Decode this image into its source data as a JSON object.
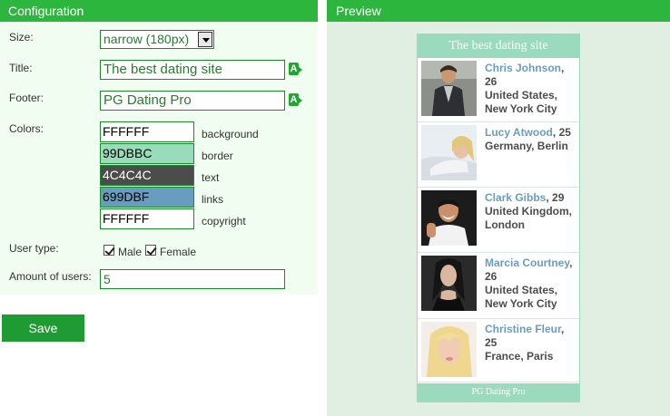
{
  "config": {
    "header": "Configuration",
    "size": {
      "label": "Size:",
      "value": "narrow (180px)"
    },
    "title": {
      "label": "Title:",
      "value": "The best dating site"
    },
    "footer": {
      "label": "Footer:",
      "value": "PG Dating Pro"
    },
    "colors": {
      "label": "Colors:",
      "items": [
        {
          "value": "FFFFFF",
          "name": "background",
          "bg": "#FFFFFF",
          "fg": "#000000"
        },
        {
          "value": "99DBBC",
          "name": "border",
          "bg": "#99DBBC",
          "fg": "#000000"
        },
        {
          "value": "4C4C4C",
          "name": "text",
          "bg": "#4C4C4C",
          "fg": "#FFFFFF"
        },
        {
          "value": "699DBF",
          "name": "links",
          "bg": "#699DBF",
          "fg": "#000000"
        },
        {
          "value": "FFFFFF",
          "name": "copyright",
          "bg": "#FFFFFF",
          "fg": "#000000"
        }
      ]
    },
    "user_type": {
      "label": "User type:",
      "male": "Male",
      "female": "Female",
      "male_checked": true,
      "female_checked": true
    },
    "amount": {
      "label": "Amount of users:",
      "value": "5"
    },
    "save_label": "Save"
  },
  "preview": {
    "header": "Preview",
    "widget_title": "The best dating site",
    "widget_footer": "PG Dating Pro",
    "users": [
      {
        "name": "Chris Johnson",
        "age": "26",
        "location": "United States, New York City"
      },
      {
        "name": "Lucy Atwood",
        "age": "25",
        "location": "Germany, Berlin"
      },
      {
        "name": "Clark Gibbs",
        "age": "29",
        "location": "United Kingdom, London"
      },
      {
        "name": "Marcia Courtney",
        "age": "26",
        "location": "United States, New York City"
      },
      {
        "name": "Christine Fleur",
        "age": "25",
        "location": "France, Paris"
      }
    ]
  },
  "colors": {
    "accent": "#2db63d",
    "save": "#1f9b34",
    "preview_bg": "#e0efe2",
    "config_bg": "#f2fdf2"
  }
}
